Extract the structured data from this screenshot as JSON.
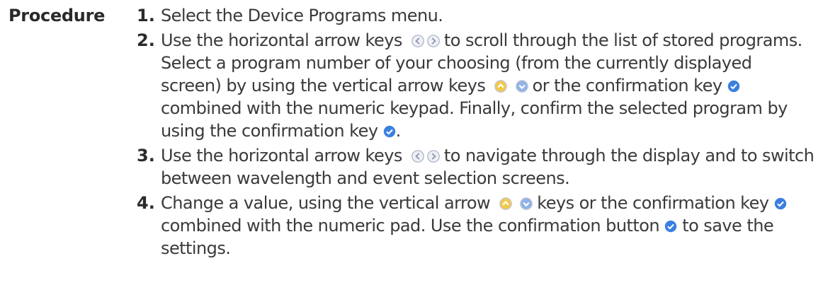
{
  "section": {
    "heading": "Procedure"
  },
  "steps": [
    {
      "number": "1.",
      "line": "Select the Device Programs menu."
    },
    {
      "number": "2.",
      "a": "Use the horizontal arrow keys",
      "b": "to scroll through the list of stored programs. Select a program number of your choosing (from the currently displayed screen) by using the vertical arrow keys",
      "c": "or the confirmation key",
      "d": "combined with the numeric keypad. Finally, confirm the selected program by using the confirmation key",
      "e": "."
    },
    {
      "number": "3.",
      "a": "Use the horizontal arrow keys",
      "b": "to navigate through the display and to switch between wavelength and event selection screens."
    },
    {
      "number": "4.",
      "a": "Change a value, using the vertical arrow",
      "b": "keys or the confirmation key",
      "c": "combined with the numeric pad. Use the confirmation button",
      "d": "to save the settings."
    }
  ],
  "colors": {
    "confirm_key": "#3b7fe0",
    "arrow_key_fill": "#eef0f6",
    "vertical_key_fill": "#f2c94c",
    "vertical_key_down_fill": "#8fb2e8"
  }
}
